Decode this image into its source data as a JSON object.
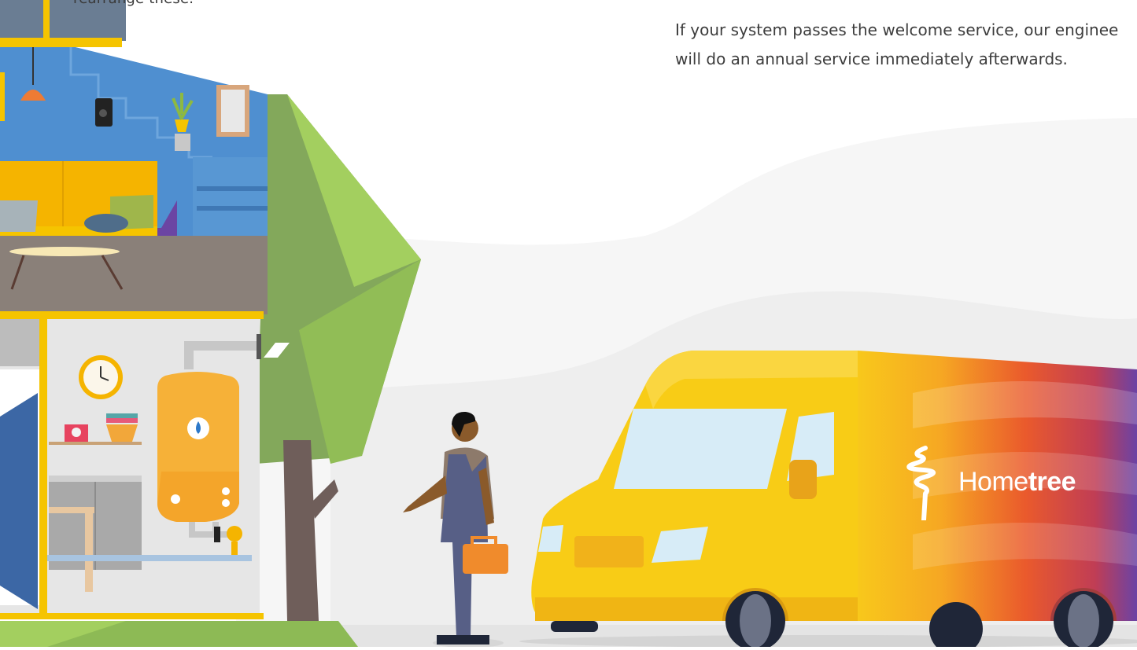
{
  "text": {
    "top_fragment": "rearrange these.",
    "intro_line_1": "If your system passes the welcome service, our enginee",
    "intro_line_2": "will do an annual service immediately afterwards."
  },
  "brand": {
    "name_regular": "Home",
    "name_bold": "tree"
  },
  "colors": {
    "yellow": "#f5c400",
    "wall_blue": "#4f8fd0",
    "sofa_purple": "#6b45a3",
    "tree_green": "#a3cf5f",
    "gradient_orange": "#f07b1c",
    "gradient_red": "#e3442c",
    "gradient_purple": "#7a4aa8"
  }
}
